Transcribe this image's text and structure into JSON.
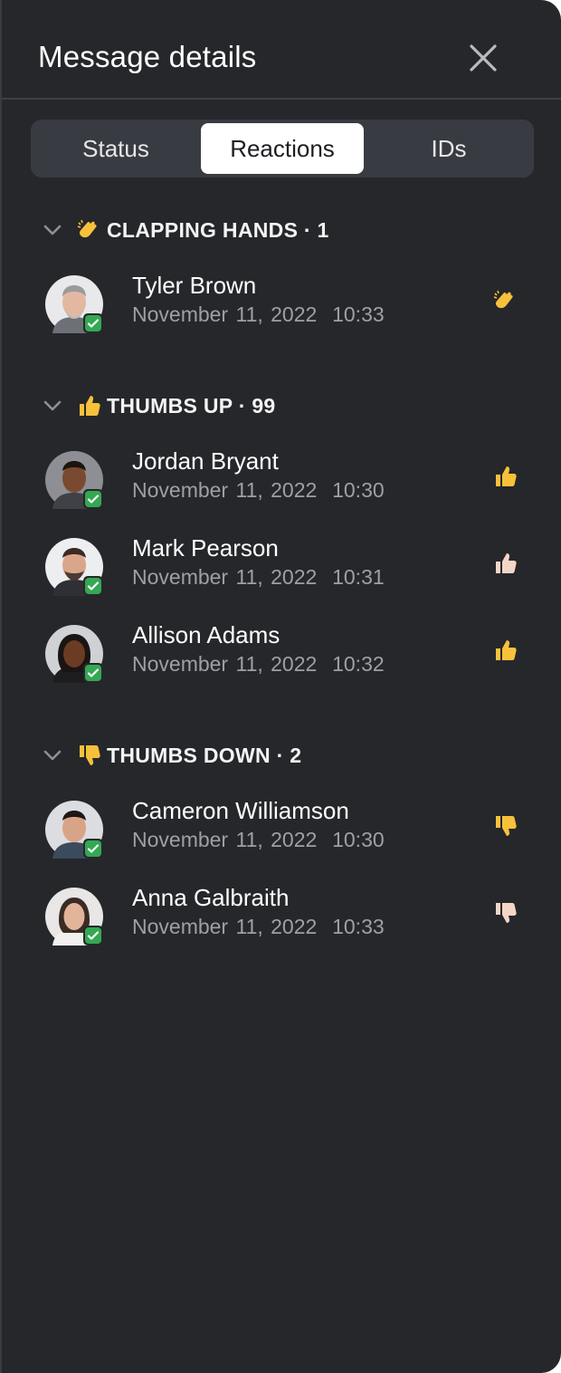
{
  "panel": {
    "title": "Message details"
  },
  "tabs": [
    {
      "label": "Status",
      "active": false
    },
    {
      "label": "Reactions",
      "active": true
    },
    {
      "label": "IDs",
      "active": false
    }
  ],
  "groups": [
    {
      "label": "CLAPPING HANDS · 1",
      "icon": "clapping-hands-icon",
      "people": [
        {
          "name": "Tyler Brown",
          "date": "November 11, 2022",
          "time": "10:33",
          "reaction": "clapping-hands-icon"
        }
      ]
    },
    {
      "label": "THUMBS UP · 99",
      "icon": "thumbs-up-icon",
      "people": [
        {
          "name": "Jordan Bryant",
          "date": "November 11, 2022",
          "time": "10:30",
          "reaction": "thumbs-up-icon"
        },
        {
          "name": "Mark Pearson",
          "date": "November 11, 2022",
          "time": "10:31",
          "reaction": "thumbs-up-light-icon"
        },
        {
          "name": "Allison Adams",
          "date": "November 11, 2022",
          "time": "10:32",
          "reaction": "thumbs-up-icon"
        }
      ]
    },
    {
      "label": "THUMBS DOWN · 2",
      "icon": "thumbs-down-icon",
      "people": [
        {
          "name": "Cameron Williamson",
          "date": "November 11, 2022",
          "time": "10:30",
          "reaction": "thumbs-down-icon"
        },
        {
          "name": "Anna Galbraith",
          "date": "November 11, 2022",
          "time": "10:33",
          "reaction": "thumbs-down-light-icon"
        }
      ]
    }
  ],
  "colors": {
    "panel_bg": "#26272b",
    "tab_track": "#393b42",
    "active_tab": "#ffffff",
    "status_green": "#34a853",
    "emoji_yellow": "#f7c13a"
  }
}
